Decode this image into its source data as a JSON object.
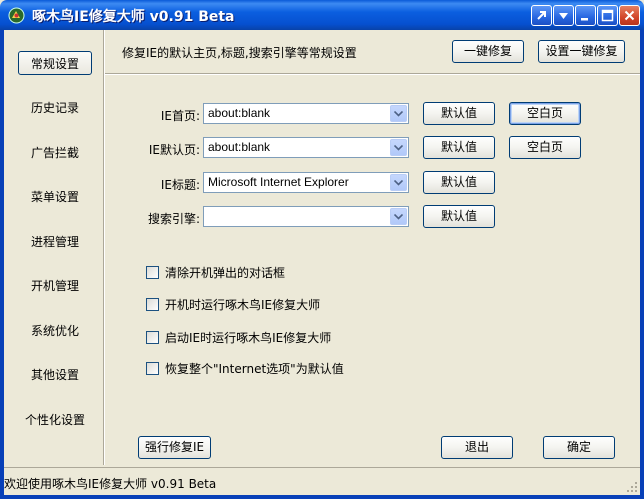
{
  "window": {
    "title": "啄木鸟IE修复大师 v0.91 Beta",
    "controls": [
      "help-icon",
      "menu-icon",
      "minimize-icon",
      "maximize-icon",
      "close-icon"
    ]
  },
  "sidebar": {
    "items": [
      {
        "label": "常规设置",
        "active": true
      },
      {
        "label": "历史记录"
      },
      {
        "label": "广告拦截"
      },
      {
        "label": "菜单设置"
      },
      {
        "label": "进程管理"
      },
      {
        "label": "开机管理"
      },
      {
        "label": "系统优化"
      },
      {
        "label": "其他设置"
      },
      {
        "label": "个性化设置"
      }
    ]
  },
  "main": {
    "description": "修复IE的默认主页,标题,搜索引擎等常规设置",
    "one_click_fix": "一键修复",
    "set_one_click_fix": "设置一键修复",
    "fields": {
      "homepage": {
        "label": "IE首页:",
        "value": "about:blank",
        "default_btn": "默认值",
        "blank_btn": "空白页"
      },
      "default_page": {
        "label": "IE默认页:",
        "value": "about:blank",
        "default_btn": "默认值",
        "blank_btn": "空白页"
      },
      "title": {
        "label": "IE标题:",
        "value": "Microsoft Internet Explorer",
        "default_btn": "默认值"
      },
      "search": {
        "label": "搜索引擎:",
        "value": "",
        "default_btn": "默认值"
      }
    },
    "checkboxes": [
      {
        "label": "清除开机弹出的对话框",
        "checked": false
      },
      {
        "label": "开机时运行啄木鸟IE修复大师",
        "checked": false
      },
      {
        "label": "启动IE时运行啄木鸟IE修复大师",
        "checked": false
      },
      {
        "label": "恢复整个\"Internet选项\"为默认值",
        "checked": false
      }
    ],
    "force_fix": "强行修复IE",
    "exit": "退出",
    "ok": "确定"
  },
  "status": {
    "text": "欢迎使用啄木鸟IE修复大师 v0.91 Beta"
  },
  "colors": {
    "titlebar": "#0b5fe0",
    "window_bg": "#ece9d8",
    "button_border": "#003c74"
  }
}
